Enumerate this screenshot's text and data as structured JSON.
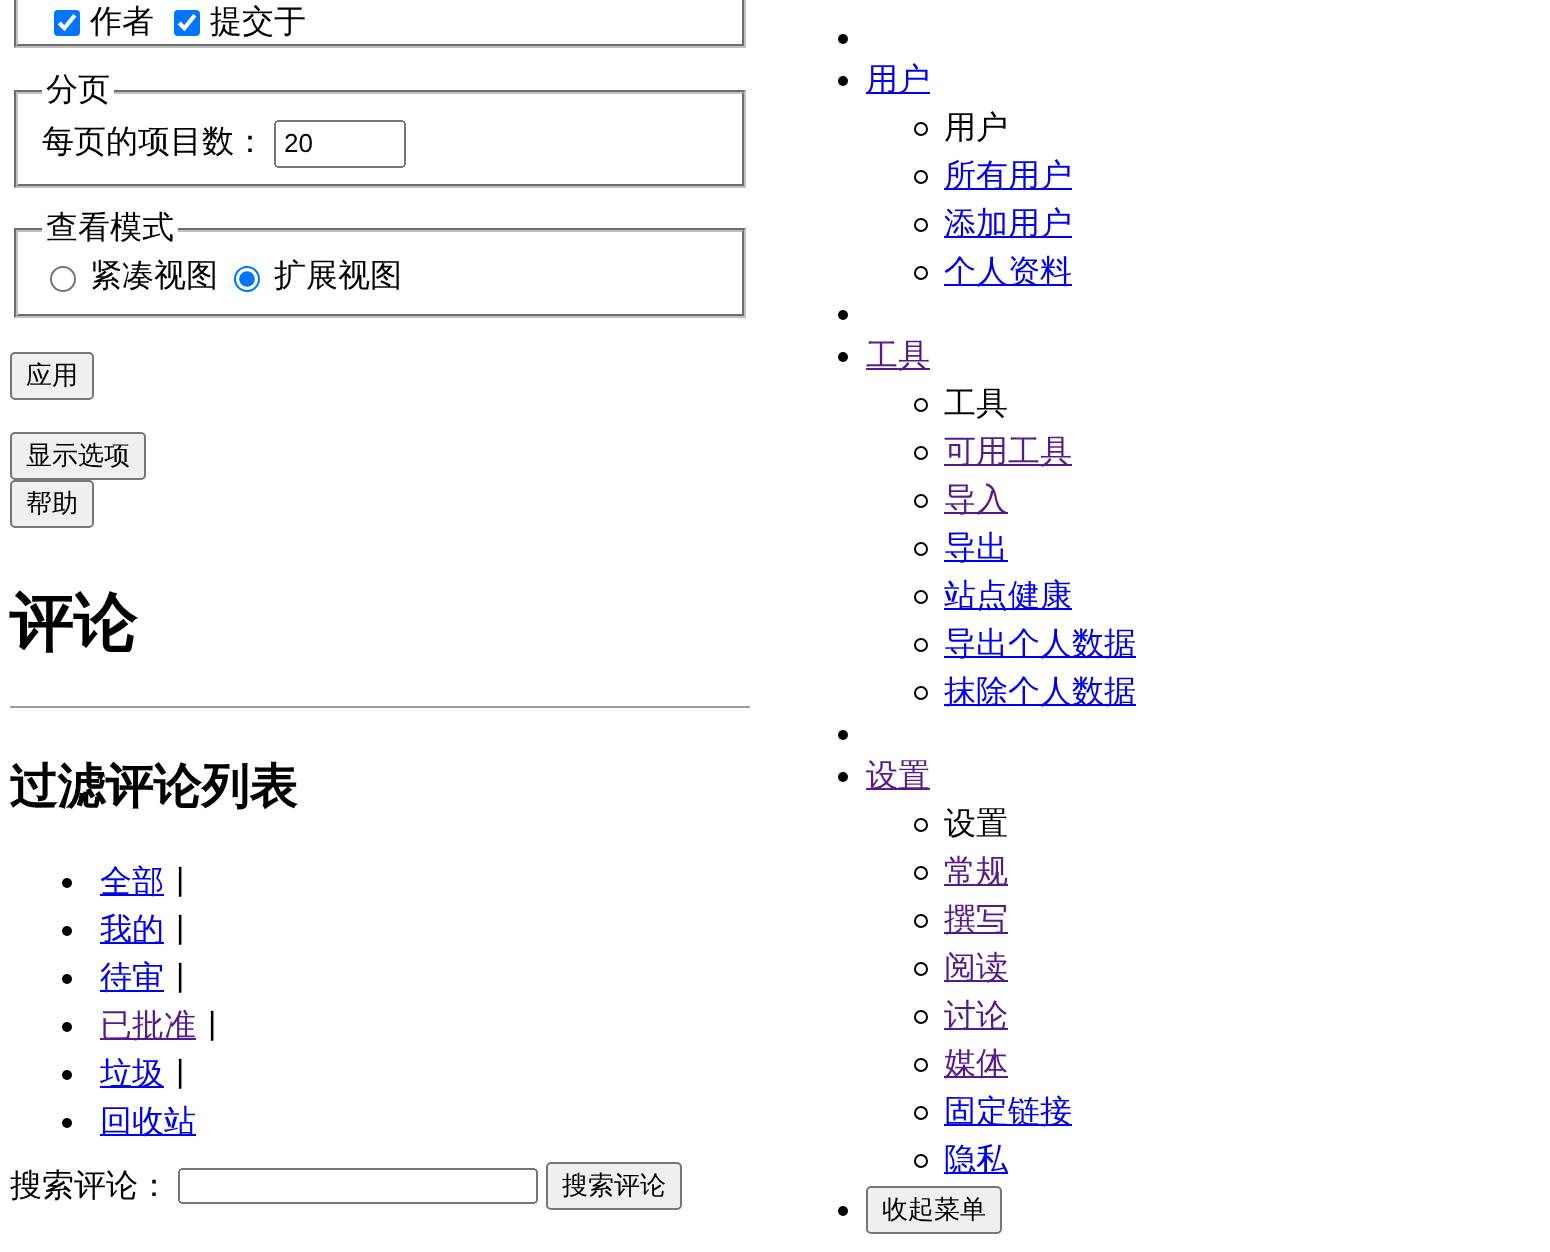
{
  "screen_options": {
    "columns": [
      {
        "label": "作者",
        "checked": true
      },
      {
        "label": "提交于",
        "checked": true
      }
    ]
  },
  "pagination": {
    "legend": "分页",
    "label": "每页的项目数：",
    "value": "20"
  },
  "view_mode": {
    "legend": "查看模式",
    "options": [
      {
        "label": "紧凑视图",
        "selected": false
      },
      {
        "label": "扩展视图",
        "selected": true
      }
    ]
  },
  "apply_button": "应用",
  "help_tabs": [
    "显示选项",
    "帮助"
  ],
  "title": "评论",
  "filter_heading": "过滤评论列表",
  "status_links": [
    {
      "label": "全部",
      "visited": false,
      "separator": "|"
    },
    {
      "label": "我的",
      "visited": false,
      "separator": "|"
    },
    {
      "label": "待审",
      "visited": false,
      "separator": "|"
    },
    {
      "label": "已批准",
      "visited": true,
      "separator": "|"
    },
    {
      "label": "垃圾",
      "visited": false,
      "separator": "|"
    },
    {
      "label": "回收站",
      "visited": false
    }
  ],
  "search": {
    "label": "搜索评论：",
    "button": "搜索评论"
  },
  "admin_menu": {
    "items": [
      {
        "kind": "separator"
      },
      {
        "kind": "menu",
        "label": "用户",
        "visited": false,
        "children": [
          {
            "label": "用户",
            "current": true
          },
          {
            "label": "所有用户",
            "current": false,
            "visited": false
          },
          {
            "label": "添加用户",
            "current": false,
            "visited": false
          },
          {
            "label": "个人资料",
            "current": false,
            "visited": false
          }
        ]
      },
      {
        "kind": "separator"
      },
      {
        "kind": "menu",
        "label": "工具",
        "visited": true,
        "children": [
          {
            "label": "工具",
            "current": true
          },
          {
            "label": "可用工具",
            "current": false,
            "visited": true
          },
          {
            "label": "导入",
            "current": false,
            "visited": true
          },
          {
            "label": "导出",
            "current": false,
            "visited": false
          },
          {
            "label": "站点健康",
            "current": false,
            "visited": false
          },
          {
            "label": "导出个人数据",
            "current": false,
            "visited": false
          },
          {
            "label": "抹除个人数据",
            "current": false,
            "visited": false
          }
        ]
      },
      {
        "kind": "separator"
      },
      {
        "kind": "menu",
        "label": "设置",
        "visited": true,
        "children": [
          {
            "label": "设置",
            "current": true
          },
          {
            "label": "常规",
            "current": false,
            "visited": true
          },
          {
            "label": "撰写",
            "current": false,
            "visited": true
          },
          {
            "label": "阅读",
            "current": false,
            "visited": true
          },
          {
            "label": "讨论",
            "current": false,
            "visited": true
          },
          {
            "label": "媒体",
            "current": false,
            "visited": true
          },
          {
            "label": "固定链接",
            "current": false,
            "visited": false
          },
          {
            "label": "隐私",
            "current": false,
            "visited": false
          }
        ]
      },
      {
        "kind": "collapse",
        "label": "收起菜单"
      }
    ]
  }
}
